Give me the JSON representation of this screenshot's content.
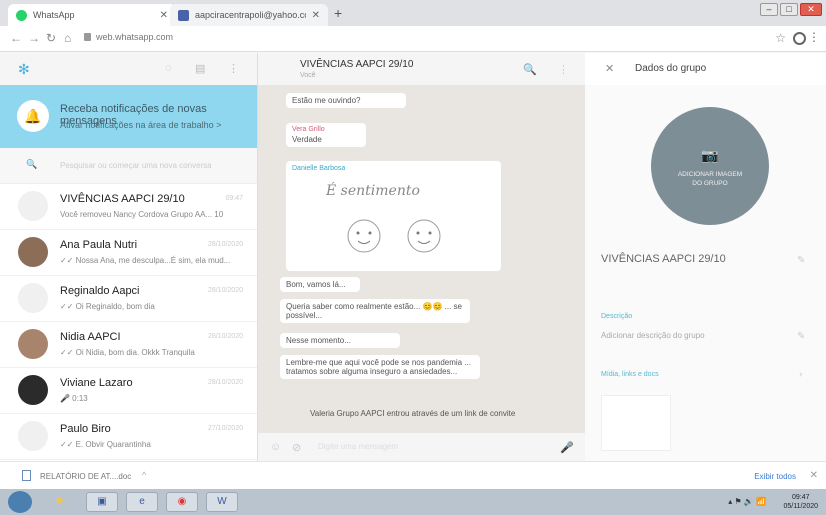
{
  "browser": {
    "tabs": [
      {
        "title": "WhatsApp",
        "fav_color": "#25d366",
        "active": true
      },
      {
        "title": "aapciracentrapoli@yahoo.com.br",
        "fav_color": "#4a62a8",
        "active": false
      }
    ],
    "url": "web.whatsapp.com"
  },
  "sidebar": {
    "notification": {
      "title": "Receba notificações de novas mensagens",
      "link": "Ativar notificações na área de trabalho >"
    },
    "search_placeholder": "Pesquisar ou começar uma nova conversa",
    "chats": [
      {
        "name": "VIVÊNCIAS AAPCI 29/10",
        "time": "09:47",
        "preview": "Você removeu Nancy Cordova Grupo AA... 10"
      },
      {
        "name": "Ana Paula Nutri",
        "time": "28/10/2020",
        "preview": "✓✓ Nossa Ana, me desculpa...É sim, ela mud..."
      },
      {
        "name": "Reginaldo Aapci",
        "time": "28/10/2020",
        "preview": "✓✓ Oi Reginaldo, bom dia"
      },
      {
        "name": "Nidia AAPCI",
        "time": "28/10/2020",
        "preview": "✓✓ Oi Nidia, bom dia. Okkk Tranquila"
      },
      {
        "name": "Viviane Lazaro",
        "time": "28/10/2020",
        "preview": "🎤 0:13"
      },
      {
        "name": "Paulo Biro",
        "time": "27/10/2020",
        "preview": "✓✓ E. Obvir Quarantinha"
      }
    ]
  },
  "conversation": {
    "title": "VIVÊNCIAS AAPCI 29/10",
    "subtitle": "Você",
    "messages": [
      {
        "sender": "",
        "text": "Estão me ouvindo?"
      },
      {
        "sender": "Vera Grillo",
        "text": "Verdade"
      },
      {
        "sender": "Danielle Barbosa",
        "text": "É sentimento"
      },
      {
        "sender": "",
        "text": "Bom, vamos lá..."
      },
      {
        "sender": "",
        "text": "Queria saber como realmente estão... 😊😊 ... se possível..."
      },
      {
        "sender": "",
        "text": "Nesse momento..."
      },
      {
        "sender": "",
        "text": "Lembre-me que aqui você pode se nos pandemia ... tratamos sobre alguma inseguro a ansiedades..."
      }
    ],
    "system_message": "Valeria Grupo AAPCI entrou através de um link de convite",
    "compose_placeholder": "Digite uma mensagem"
  },
  "group_info": {
    "header": "Dados do grupo",
    "image_caption": "ADICIONAR IMAGEM DO GRUPO",
    "name": "VIVÊNCIAS AAPCI 29/10",
    "description_label": "Descrição",
    "description_value": "Adicionar descrição do grupo",
    "media_label": "Mídia, links e docs"
  },
  "downloads": {
    "file": "RELATÓRIO DE AT....doc",
    "show_all": "Exibir todos"
  },
  "taskbar": {
    "clock_time": "09:47",
    "clock_date": "05/11/2020"
  }
}
